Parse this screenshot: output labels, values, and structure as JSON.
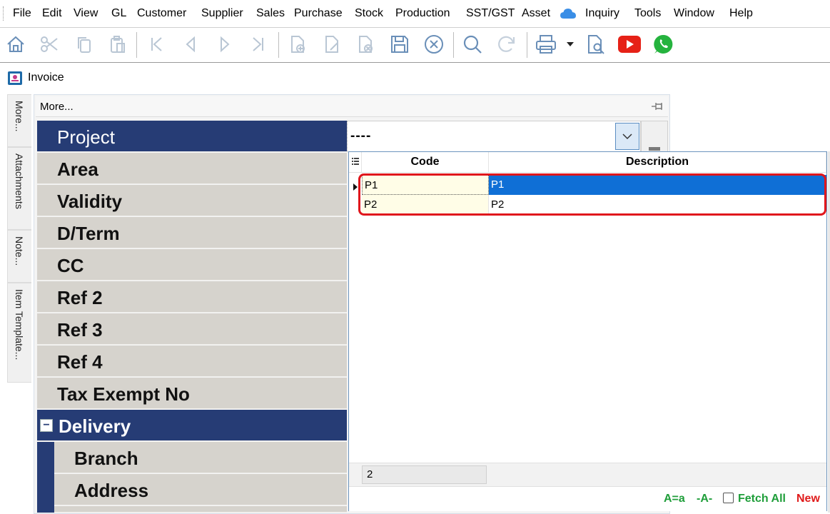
{
  "menu": [
    "File",
    "Edit",
    "View",
    "GL",
    "Customer",
    "Supplier",
    "Sales",
    "Purchase",
    "Stock",
    "Production",
    "SST/GST",
    "Asset",
    "Inquiry",
    "Tools",
    "Window",
    "Help"
  ],
  "icons": {
    "toolbar": [
      "home-icon",
      "cut-icon",
      "copy-icon",
      "paste-icon",
      "first-record-icon",
      "previous-record-icon",
      "next-record-icon",
      "last-record-icon",
      "new-document-icon",
      "edit-document-icon",
      "delete-document-icon",
      "save-icon",
      "cancel-icon",
      "search-icon",
      "refresh-icon",
      "print-icon",
      "print-dropdown-icon",
      "preview-icon",
      "youtube-icon",
      "whatsapp-icon"
    ],
    "cloud": "cloud-icon",
    "pin": "pin-icon"
  },
  "colors": {
    "header_navy": "#263c75",
    "label_grey": "#d6d3cd",
    "selection_blue": "#0f6fd6",
    "code_cell": "#fffde7",
    "highlight_red": "#e0161c",
    "green_text": "#1f9e3a",
    "red_text": "#e01b1b",
    "youtube_red": "#e62117",
    "whatsapp_green": "#25b33e"
  },
  "document": {
    "title": "Invoice"
  },
  "side_tabs": [
    "More...",
    "Attachments",
    "Note...",
    "Item Template..."
  ],
  "panel": {
    "header": "More...",
    "labels": [
      "Project",
      "Area",
      "Validity",
      "D/Term",
      "CC",
      "Ref 2",
      "Ref 3",
      "Ref 4",
      "Tax Exempt No"
    ],
    "section": {
      "toggle": "−",
      "name": "Delivery"
    },
    "sub_labels": [
      "Branch",
      "Address"
    ]
  },
  "combo": {
    "value": "----"
  },
  "dropdown": {
    "columns": [
      "Code",
      "Description"
    ],
    "rows": [
      {
        "code": "P1",
        "description": "P1"
      },
      {
        "code": "P2",
        "description": "P2"
      }
    ],
    "record_count": "2",
    "options": {
      "case": "A=a",
      "partial": "-A-",
      "fetch_all": "Fetch All",
      "new": "New"
    }
  }
}
